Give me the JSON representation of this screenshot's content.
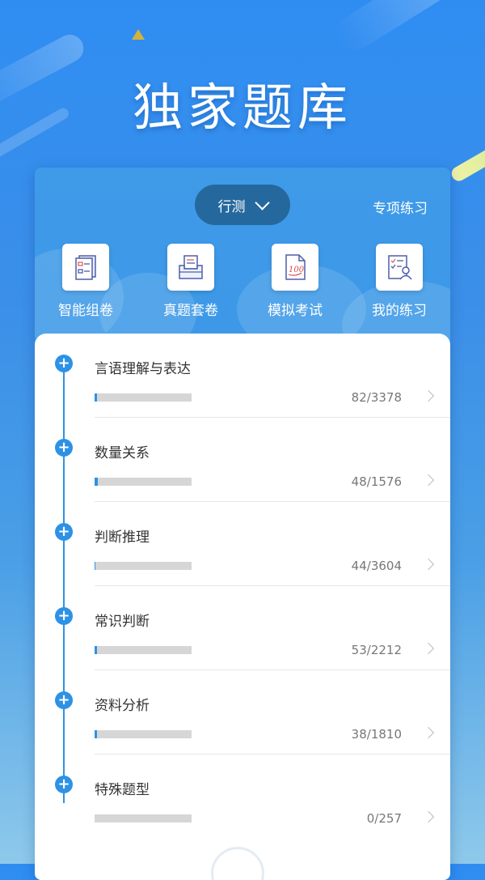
{
  "hero": {
    "title": "独家题库"
  },
  "card": {
    "subject_selector": "行测",
    "special_practice": "专项练习",
    "features": [
      {
        "label": "智能组卷",
        "icon": "list-paper-icon"
      },
      {
        "label": "真题套卷",
        "icon": "paper-tray-icon"
      },
      {
        "label": "模拟考试",
        "icon": "score-100-icon"
      },
      {
        "label": "我的练习",
        "icon": "checklist-user-icon"
      }
    ]
  },
  "categories": [
    {
      "name": "言语理解与表达",
      "count": "82/3378",
      "progress": 0.024
    },
    {
      "name": "数量关系",
      "count": "48/1576",
      "progress": 0.03
    },
    {
      "name": "判断推理",
      "count": "44/3604",
      "progress": 0.012
    },
    {
      "name": "常识判断",
      "count": "53/2212",
      "progress": 0.024
    },
    {
      "name": "资料分析",
      "count": "38/1810",
      "progress": 0.021
    },
    {
      "name": "特殊题型",
      "count": "0/257",
      "progress": 0
    }
  ],
  "colors": {
    "accent": "#2d92e6",
    "pill": "#25689d",
    "bar_bg": "#d6d6d6"
  }
}
